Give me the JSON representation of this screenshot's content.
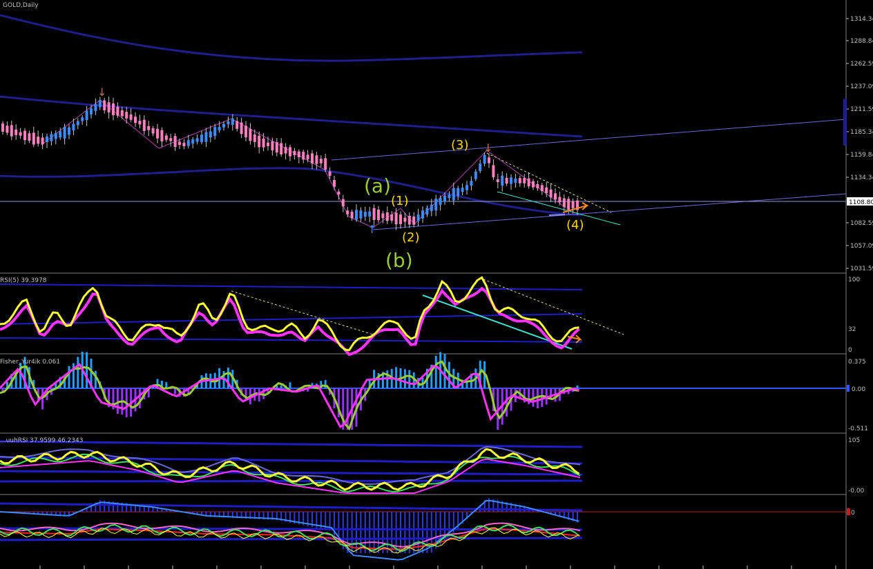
{
  "window": {
    "symbol_title": "GOLD,Daily"
  },
  "colors": {
    "background": "#000000",
    "bull_candle": "#3d8bff",
    "bear_candle": "#ff7fbf",
    "wick": "#c8c8c8",
    "band": "#1e1e8c",
    "trendline": "#6a6ad8",
    "wave_label": "#ffd700",
    "corrective_label": "#9acd32",
    "rsi_main": "#ffff33",
    "rsi_signal": "#ff33ff",
    "fisher_line": "#ff33ff",
    "fisher_signal": "#9acd32",
    "fisher_hist_pos": "#1ea0ff",
    "fisher_hist_neg": "#9933ff",
    "current_price_bg": "#ffffff",
    "arrow_orange": "#ff8c1a",
    "zero_line": "#3355ff",
    "red_line": "#c81e1e"
  },
  "price_axis": {
    "ticks": [
      "1314.34",
      "1288.84",
      "1262.59",
      "1237.09",
      "1211.59",
      "1185.34",
      "1159.84",
      "1134.34",
      "1108.80",
      "1082.59",
      "1057.09",
      "1031.59"
    ],
    "current_price": "1108.80"
  },
  "wave_labels": {
    "w1": "(1)",
    "w2": "(2)",
    "w3": "(3)",
    "w4": "(4)",
    "wa": "(a)",
    "wb": "(b)"
  },
  "panels": {
    "rsi": {
      "title": "RSI(5) 39.3978",
      "scale": [
        "100",
        "32",
        "0"
      ]
    },
    "fisher": {
      "title": "Fisher_Yur4ik 0.061",
      "scale": [
        "0.375",
        "0.00",
        "-0.511"
      ]
    },
    "panel3": {
      "title": "...uuhRSI 37.9599 46.2343",
      "scale": [
        "105",
        "-0.00"
      ]
    },
    "panel4": {
      "scale": [
        "0"
      ]
    }
  }
}
